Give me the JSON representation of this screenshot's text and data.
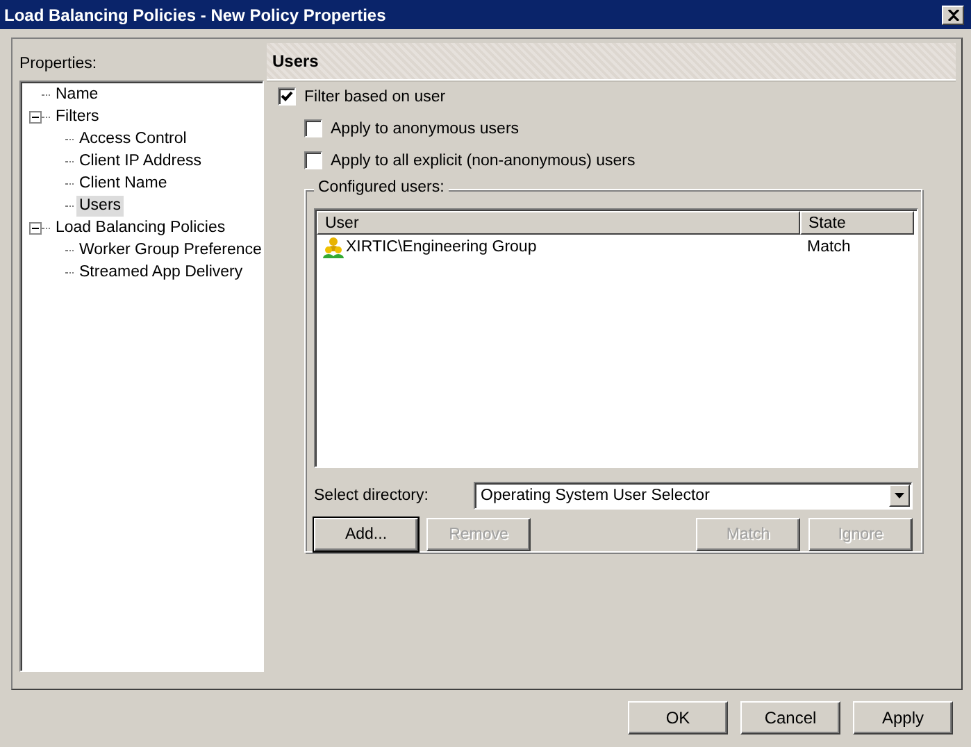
{
  "window": {
    "title": "Load Balancing Policies - New Policy Properties"
  },
  "sidebar": {
    "label": "Properties:",
    "items": [
      {
        "label": "Name",
        "selected": false
      },
      {
        "label": "Filters",
        "selected": false,
        "expanded": true,
        "children": [
          {
            "label": "Access Control",
            "selected": false
          },
          {
            "label": "Client IP Address",
            "selected": false
          },
          {
            "label": "Client Name",
            "selected": false
          },
          {
            "label": "Users",
            "selected": true
          }
        ]
      },
      {
        "label": "Load Balancing Policies",
        "selected": false,
        "expanded": true,
        "children": [
          {
            "label": "Worker Group Preference",
            "selected": false
          },
          {
            "label": "Streamed App Delivery",
            "selected": false
          }
        ]
      }
    ]
  },
  "panel": {
    "title": "Users",
    "options": [
      {
        "label": "Filter based on user",
        "checked": true
      },
      {
        "label": "Apply to anonymous users",
        "checked": false
      },
      {
        "label": "Apply to all explicit (non-anonymous) users",
        "checked": false
      }
    ],
    "group_title": "Configured users:",
    "table": {
      "columns": [
        "User",
        "State"
      ],
      "rows": [
        {
          "user": "XIRTIC\\Engineering Group",
          "state": "Match"
        }
      ]
    },
    "directory_label": "Select directory:",
    "directory_value": "Operating System User Selector",
    "buttons": [
      {
        "label": "Add...",
        "disabled": false
      },
      {
        "label": "Remove",
        "disabled": true
      },
      {
        "label": "Match",
        "disabled": true
      },
      {
        "label": "Ignore",
        "disabled": true
      }
    ]
  },
  "buttons": [
    "OK",
    "Cancel",
    "Apply"
  ]
}
